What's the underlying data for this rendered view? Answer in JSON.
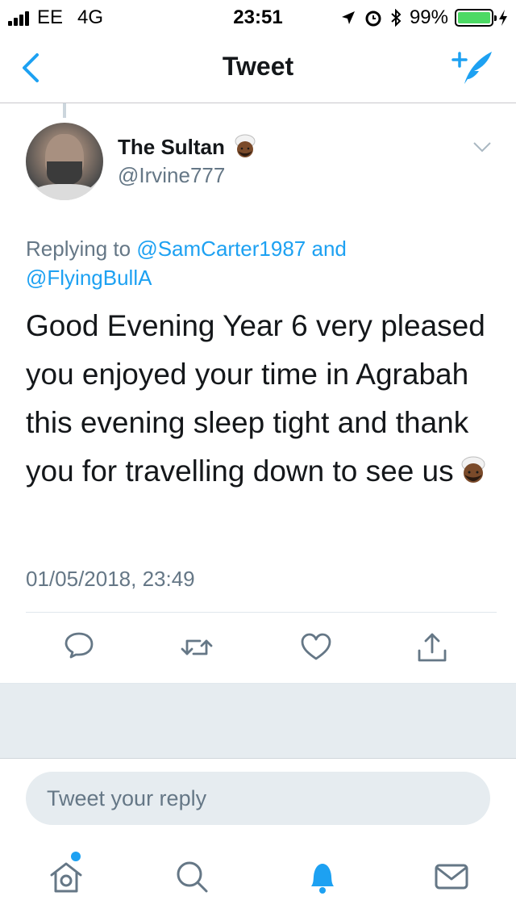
{
  "status_bar": {
    "carrier": "EE",
    "network": "4G",
    "time": "23:51",
    "battery": "99%",
    "battery_level": 0.99
  },
  "nav": {
    "title": "Tweet",
    "back_icon": "chevron-left-icon",
    "compose_icon": "compose-tweet-icon"
  },
  "tweet": {
    "author_name": "The Sultan",
    "author_handle": "@Irvine777",
    "replying_prefix": "Replying to",
    "replying_mention_1": "@SamCarter1987",
    "replying_and": "and",
    "replying_mention_2": "@FlyingBullA",
    "text": "Good Evening Year 6 very pleased you enjoyed your time in Agrabah this evening sleep tight and thank you for travelling down to see us",
    "timestamp": "01/05/2018, 23:49"
  },
  "reply": {
    "placeholder": "Tweet your reply"
  },
  "colors": {
    "accent": "#1da1f2",
    "secondary_text": "#657786",
    "battery": "#4cd964"
  },
  "tabs": [
    "home-icon",
    "search-icon",
    "notifications-icon",
    "messages-icon"
  ]
}
